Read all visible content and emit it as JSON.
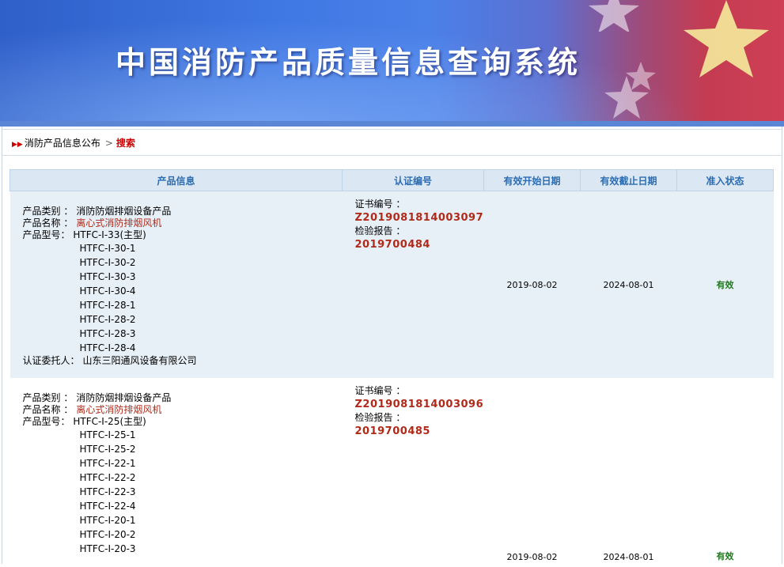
{
  "banner": {
    "title": "中国消防产品质量信息查询系统"
  },
  "breadcrumb": {
    "parent": "消防产品信息公布",
    "separator": ">",
    "current": "搜索"
  },
  "table": {
    "headers": {
      "product": "产品信息",
      "cert": "认证编号",
      "start": "有效开始日期",
      "end": "有效截止日期",
      "status": "准入状态"
    },
    "rows": [
      {
        "category_label": "产品类别 ：",
        "category": "消防防烟排烟设备产品",
        "name_label": "产品名称 ：",
        "name": "离心式消防排烟风机",
        "model_label": "产品型号：",
        "models": [
          "HTFC-I-33(主型)",
          "HTFC-I-30-1",
          "HTFC-I-30-2",
          "HTFC-I-30-3",
          "HTFC-I-30-4",
          "HTFC-I-28-1",
          "HTFC-I-28-2",
          "HTFC-I-28-3",
          "HTFC-I-28-4"
        ],
        "client_label": "认证委托人：",
        "client": "山东三阳通风设备有限公司",
        "cert_label": "证书编号 ：",
        "cert_no": "Z2019081814003097",
        "report_label": "检验报告 ：",
        "report_no": "2019700484",
        "start": "2019-08-02",
        "end": "2024-08-01",
        "status": "有效"
      },
      {
        "category_label": "产品类别 ：",
        "category": "消防防烟排烟设备产品",
        "name_label": "产品名称 ：",
        "name": "离心式消防排烟风机",
        "model_label": "产品型号：",
        "models": [
          "HTFC-I-25(主型)",
          "HTFC-I-25-1",
          "HTFC-I-25-2",
          "HTFC-I-22-1",
          "HTFC-I-22-2",
          "HTFC-I-22-3",
          "HTFC-I-22-4",
          "HTFC-I-20-1",
          "HTFC-I-20-2",
          "HTFC-I-20-3"
        ],
        "cert_label": "证书编号 ：",
        "cert_no": "Z2019081814003096",
        "report_label": "检验报告 ：",
        "report_no": "2019700485",
        "start": "2019-08-02",
        "end": "2024-08-01",
        "status": "有效"
      }
    ]
  },
  "colors": {
    "banner_blue": "#3f77e3",
    "flag_red": "#cf3f55",
    "header_text": "#2b6cb2",
    "value_red": "#b02a1a",
    "status_green": "#1e7a1e"
  },
  "icons": {
    "breadcrumb": "double-arrow-icon",
    "stars": "star-icon"
  }
}
